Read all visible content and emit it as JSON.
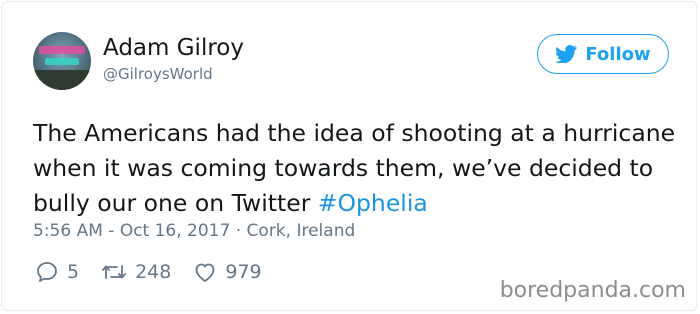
{
  "tweet": {
    "author": {
      "name": "Adam Gilroy",
      "handle": "@GilroysWorld",
      "avatar_icon": "profile-photo"
    },
    "follow_button": {
      "label": "Follow",
      "icon": "twitter-bird-icon"
    },
    "text": "The Americans had the idea of shooting at a hurricane when it was coming towards them, we’ve decided to bully our one on Twitter ",
    "hashtag": "#Ophelia",
    "timestamp": "5:56 AM - Oct 16, 2017",
    "separator": " · ",
    "location": "Cork, Ireland",
    "stats": {
      "replies": "5",
      "retweets": "248",
      "likes": "979"
    }
  },
  "watermark": "boredpanda.com",
  "colors": {
    "accent": "#1da1f2",
    "hashtag": "#1b95e0",
    "text": "#14171a",
    "muted": "#657786",
    "border": "#e6ecf0"
  }
}
